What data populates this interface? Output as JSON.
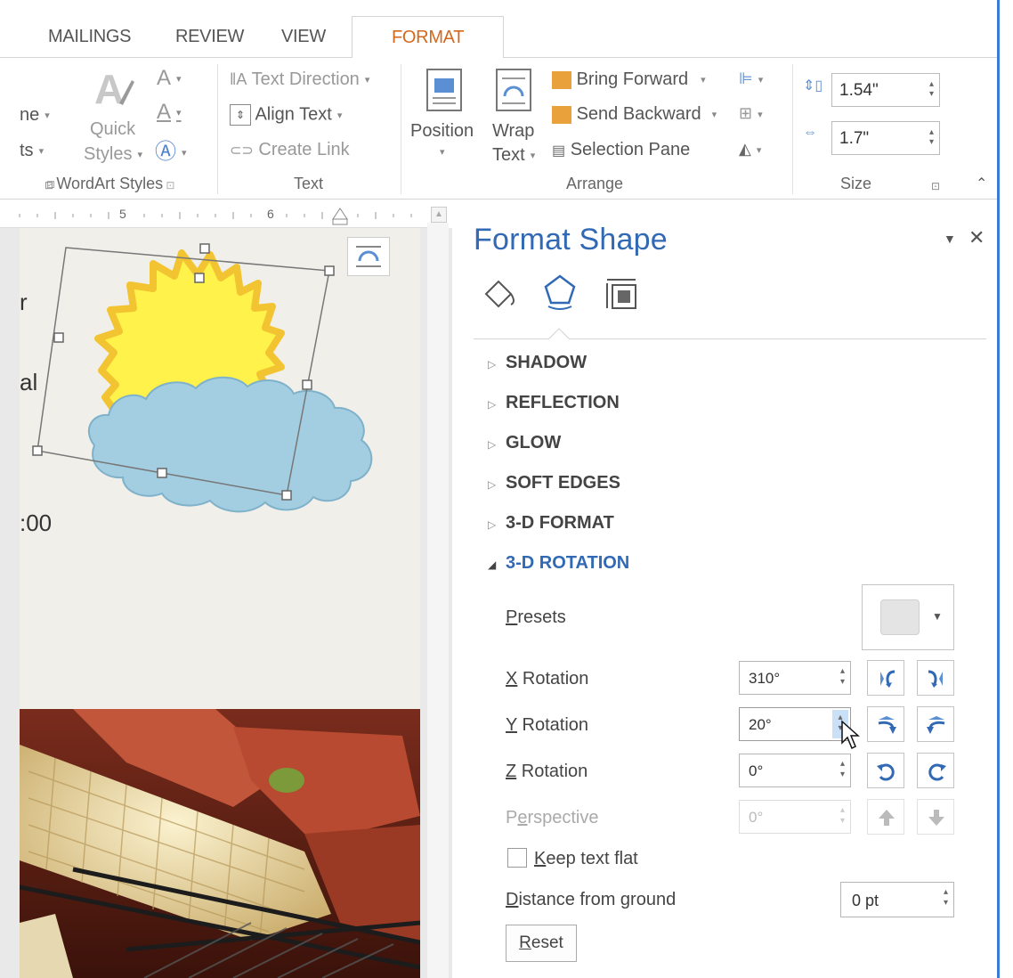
{
  "tabs": [
    "MAILINGS",
    "REVIEW",
    "VIEW",
    "FORMAT"
  ],
  "ribbon": {
    "cut_left_labels": [
      "ne",
      "ts"
    ],
    "quick_styles": [
      "Quick",
      "Styles"
    ],
    "wordart_group": "WordArt Styles",
    "text_direction": "Text Direction",
    "align_text": "Align Text",
    "create_link": "Create Link",
    "text_group": "Text",
    "position": "Position",
    "wrap_text": [
      "Wrap",
      "Text"
    ],
    "bring_forward": "Bring Forward",
    "send_backward": "Send Backward",
    "selection_pane": "Selection Pane",
    "arrange_group": "Arrange",
    "height": "1.54\"",
    "width": "1.7\"",
    "size_group": "Size"
  },
  "document": {
    "ruler_marks": [
      "5",
      "6"
    ],
    "cut_text": [
      "r",
      "al",
      ":00"
    ]
  },
  "pane": {
    "title": "Format Shape",
    "sections": [
      "SHADOW",
      "REFLECTION",
      "GLOW",
      "SOFT EDGES",
      "3-D FORMAT",
      "3-D ROTATION"
    ],
    "presets": {
      "first": "P",
      "rest": "resets"
    },
    "x_rotation": {
      "first": "X",
      "rest": " Rotation",
      "value": "310°"
    },
    "y_rotation": {
      "first": "Y",
      "rest": " Rotation",
      "value": "20°"
    },
    "z_rotation": {
      "first": "Z",
      "rest": " Rotation",
      "value": "0°"
    },
    "perspective": {
      "pre": "P",
      "u": "e",
      "rest": "rspective",
      "value": "0°"
    },
    "keep_text_flat": {
      "first": "K",
      "rest": "eep text flat"
    },
    "distance": {
      "first": "D",
      "rest": "istance from ground",
      "value": "0 pt"
    },
    "reset": {
      "first": "R",
      "rest": "eset"
    },
    "colors": {
      "accent": "#3269b4",
      "format_tab": "#d2691e"
    }
  }
}
